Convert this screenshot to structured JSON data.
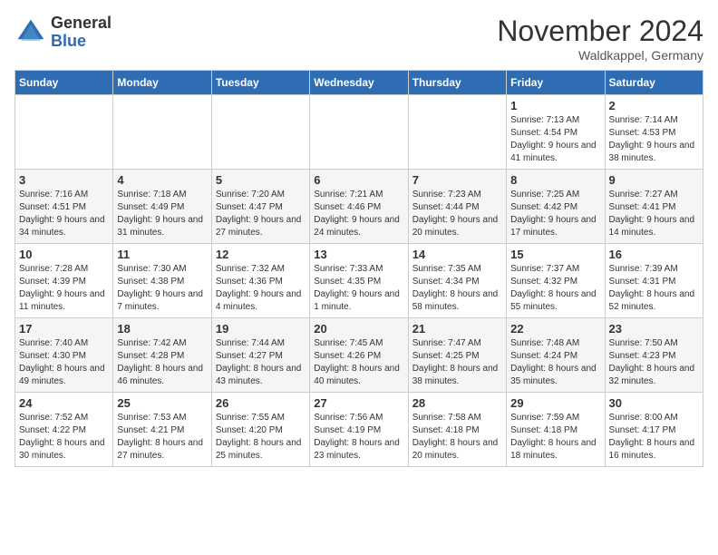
{
  "header": {
    "logo_general": "General",
    "logo_blue": "Blue",
    "month_title": "November 2024",
    "location": "Waldkappel, Germany"
  },
  "days_of_week": [
    "Sunday",
    "Monday",
    "Tuesday",
    "Wednesday",
    "Thursday",
    "Friday",
    "Saturday"
  ],
  "weeks": [
    [
      {
        "day": "",
        "info": ""
      },
      {
        "day": "",
        "info": ""
      },
      {
        "day": "",
        "info": ""
      },
      {
        "day": "",
        "info": ""
      },
      {
        "day": "",
        "info": ""
      },
      {
        "day": "1",
        "info": "Sunrise: 7:13 AM\nSunset: 4:54 PM\nDaylight: 9 hours and 41 minutes."
      },
      {
        "day": "2",
        "info": "Sunrise: 7:14 AM\nSunset: 4:53 PM\nDaylight: 9 hours and 38 minutes."
      }
    ],
    [
      {
        "day": "3",
        "info": "Sunrise: 7:16 AM\nSunset: 4:51 PM\nDaylight: 9 hours and 34 minutes."
      },
      {
        "day": "4",
        "info": "Sunrise: 7:18 AM\nSunset: 4:49 PM\nDaylight: 9 hours and 31 minutes."
      },
      {
        "day": "5",
        "info": "Sunrise: 7:20 AM\nSunset: 4:47 PM\nDaylight: 9 hours and 27 minutes."
      },
      {
        "day": "6",
        "info": "Sunrise: 7:21 AM\nSunset: 4:46 PM\nDaylight: 9 hours and 24 minutes."
      },
      {
        "day": "7",
        "info": "Sunrise: 7:23 AM\nSunset: 4:44 PM\nDaylight: 9 hours and 20 minutes."
      },
      {
        "day": "8",
        "info": "Sunrise: 7:25 AM\nSunset: 4:42 PM\nDaylight: 9 hours and 17 minutes."
      },
      {
        "day": "9",
        "info": "Sunrise: 7:27 AM\nSunset: 4:41 PM\nDaylight: 9 hours and 14 minutes."
      }
    ],
    [
      {
        "day": "10",
        "info": "Sunrise: 7:28 AM\nSunset: 4:39 PM\nDaylight: 9 hours and 11 minutes."
      },
      {
        "day": "11",
        "info": "Sunrise: 7:30 AM\nSunset: 4:38 PM\nDaylight: 9 hours and 7 minutes."
      },
      {
        "day": "12",
        "info": "Sunrise: 7:32 AM\nSunset: 4:36 PM\nDaylight: 9 hours and 4 minutes."
      },
      {
        "day": "13",
        "info": "Sunrise: 7:33 AM\nSunset: 4:35 PM\nDaylight: 9 hours and 1 minute."
      },
      {
        "day": "14",
        "info": "Sunrise: 7:35 AM\nSunset: 4:34 PM\nDaylight: 8 hours and 58 minutes."
      },
      {
        "day": "15",
        "info": "Sunrise: 7:37 AM\nSunset: 4:32 PM\nDaylight: 8 hours and 55 minutes."
      },
      {
        "day": "16",
        "info": "Sunrise: 7:39 AM\nSunset: 4:31 PM\nDaylight: 8 hours and 52 minutes."
      }
    ],
    [
      {
        "day": "17",
        "info": "Sunrise: 7:40 AM\nSunset: 4:30 PM\nDaylight: 8 hours and 49 minutes."
      },
      {
        "day": "18",
        "info": "Sunrise: 7:42 AM\nSunset: 4:28 PM\nDaylight: 8 hours and 46 minutes."
      },
      {
        "day": "19",
        "info": "Sunrise: 7:44 AM\nSunset: 4:27 PM\nDaylight: 8 hours and 43 minutes."
      },
      {
        "day": "20",
        "info": "Sunrise: 7:45 AM\nSunset: 4:26 PM\nDaylight: 8 hours and 40 minutes."
      },
      {
        "day": "21",
        "info": "Sunrise: 7:47 AM\nSunset: 4:25 PM\nDaylight: 8 hours and 38 minutes."
      },
      {
        "day": "22",
        "info": "Sunrise: 7:48 AM\nSunset: 4:24 PM\nDaylight: 8 hours and 35 minutes."
      },
      {
        "day": "23",
        "info": "Sunrise: 7:50 AM\nSunset: 4:23 PM\nDaylight: 8 hours and 32 minutes."
      }
    ],
    [
      {
        "day": "24",
        "info": "Sunrise: 7:52 AM\nSunset: 4:22 PM\nDaylight: 8 hours and 30 minutes."
      },
      {
        "day": "25",
        "info": "Sunrise: 7:53 AM\nSunset: 4:21 PM\nDaylight: 8 hours and 27 minutes."
      },
      {
        "day": "26",
        "info": "Sunrise: 7:55 AM\nSunset: 4:20 PM\nDaylight: 8 hours and 25 minutes."
      },
      {
        "day": "27",
        "info": "Sunrise: 7:56 AM\nSunset: 4:19 PM\nDaylight: 8 hours and 23 minutes."
      },
      {
        "day": "28",
        "info": "Sunrise: 7:58 AM\nSunset: 4:18 PM\nDaylight: 8 hours and 20 minutes."
      },
      {
        "day": "29",
        "info": "Sunrise: 7:59 AM\nSunset: 4:18 PM\nDaylight: 8 hours and 18 minutes."
      },
      {
        "day": "30",
        "info": "Sunrise: 8:00 AM\nSunset: 4:17 PM\nDaylight: 8 hours and 16 minutes."
      }
    ]
  ]
}
